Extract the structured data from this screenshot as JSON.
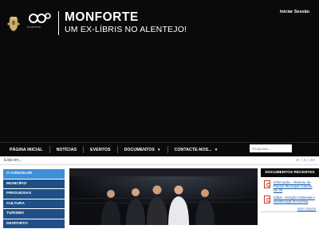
{
  "header": {
    "site_title": "MONFORTE",
    "site_subtitle": "UM EX-LÍBRIS NO ALENTEJO!",
    "brand_text": "monforte",
    "login_label": "Iniciar Sessão"
  },
  "nav": {
    "items": [
      {
        "label": "PÁGINA INICIAL",
        "dropdown": false
      },
      {
        "label": "NOTÍCIAS",
        "dropdown": false
      },
      {
        "label": "EVENTOS",
        "dropdown": false
      },
      {
        "label": "DOCUMENTOS",
        "dropdown": true
      },
      {
        "label": "CONTACTE-NOS...",
        "dropdown": true
      }
    ],
    "search_placeholder": "Pesquisar..."
  },
  "breadcrumb": {
    "text": "Está em...",
    "text_size": [
      "A-",
      "A",
      "A+"
    ]
  },
  "sidebar": {
    "items": [
      {
        "label": "O CONCELHO",
        "active": true
      },
      {
        "label": "MUNICÍPIO",
        "active": false
      },
      {
        "label": "FREGUESIAS",
        "active": false
      },
      {
        "label": "CULTURA",
        "active": false
      },
      {
        "label": "TURISMO",
        "active": false
      },
      {
        "label": "DESPORTO",
        "active": false
      }
    ]
  },
  "recent_docs": {
    "title": "DOCUMENTOS RECENTES",
    "items": [
      {
        "text": "Informação - Abertura da Piscina Municipal Coberta De 20"
      },
      {
        "text": "Edital - Isenção Ambiental e Identificação Economia"
      }
    ],
    "see_all": "VER TODOS"
  },
  "colors": {
    "header_bg": "#0a0a0a",
    "sidebar_bg": "#1f4f86",
    "sidebar_active": "#3f8fd6",
    "link": "#1a5ba6",
    "pdf_red": "#c0392b"
  }
}
